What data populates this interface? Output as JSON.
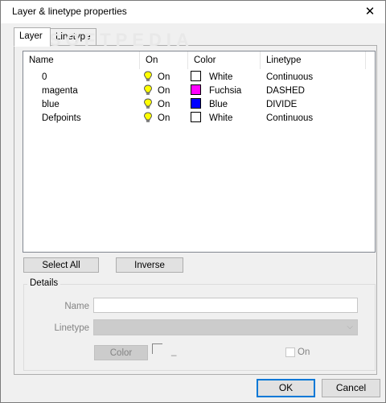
{
  "window": {
    "title": "Layer & linetype properties",
    "close_symbol": "✕"
  },
  "tabs": [
    {
      "label": "Layer"
    },
    {
      "label": "Linetype"
    }
  ],
  "watermark": "SOFTPEDIA",
  "columns": {
    "name": "Name",
    "on": "On",
    "color": "Color",
    "linetype": "Linetype"
  },
  "layers": [
    {
      "name": "0",
      "on": "On",
      "color_name": "White",
      "color_hex": "#ffffff",
      "linetype": "Continuous"
    },
    {
      "name": "magenta",
      "on": "On",
      "color_name": "Fuchsia",
      "color_hex": "#ff00ff",
      "linetype": "DASHED"
    },
    {
      "name": "blue",
      "on": "On",
      "color_name": "Blue",
      "color_hex": "#0000ff",
      "linetype": "DIVIDE"
    },
    {
      "name": "Defpoints",
      "on": "On",
      "color_name": "White",
      "color_hex": "#ffffff",
      "linetype": "Continuous"
    }
  ],
  "buttons": {
    "select_all": "Select All",
    "inverse": "Inverse",
    "ok": "OK",
    "cancel": "Cancel"
  },
  "details": {
    "group_label": "Details",
    "name_label": "Name",
    "name_value": "",
    "linetype_label": "Linetype",
    "linetype_value": "",
    "color_button": "Color",
    "color_value": "_",
    "on_label": "On"
  }
}
